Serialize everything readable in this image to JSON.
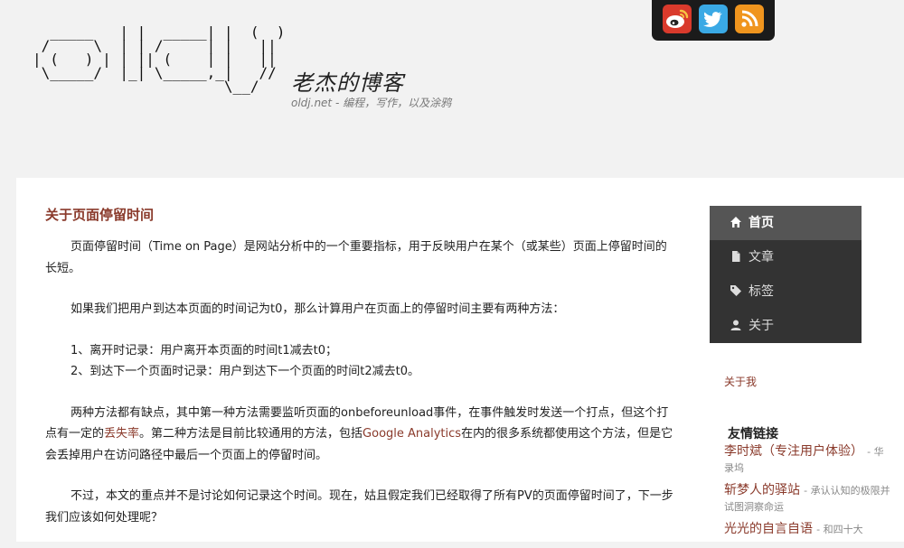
{
  "header": {
    "logo_ascii": "  _____   | |  _____| |  (  )\n /     \\  | | /     | |   ||\n| (   ) | | || (    | |   ||\n \\_____/  |_| \\_____,_|   //\n                      \\__/",
    "site_title": "老杰的博客",
    "site_subtitle": "oldj.net - 编程，写作，以及涂鸦"
  },
  "social": [
    {
      "name": "weibo",
      "icon": "weibo-icon",
      "color": "#d93a2c"
    },
    {
      "name": "twitter",
      "icon": "twitter-icon",
      "color": "#3aa9e5"
    },
    {
      "name": "rss",
      "icon": "rss-icon",
      "color": "#f0951e"
    }
  ],
  "article": {
    "title": "关于页面停留时间",
    "p1": "页面停留时间（Time on Page）是网站分析中的一个重要指标，用于反映用户在某个（或某些）页面上停留时间的长短。",
    "p2": "如果我们把用户到达本页面的时间记为t0，那么计算用户在页面上的停留时间主要有两种方法：",
    "list1": "1、离开时记录：用户离开本页面的时间t1减去t0；",
    "list2": "2、到达下一个页面时记录：用户到达下一个页面的时间t2减去t0。",
    "p3_a": "两种方法都有缺点，其中第一种方法需要监听页面的onbeforeunload事件，在事件触发时发送一个打点，但这个打点有一定的",
    "p3_link1": "丢失率",
    "p3_b": "。第二种方法是目前比较通用的方法，包括",
    "p3_link2": "Google Analytics",
    "p3_c": "在内的很多系统都使用这个方法，但是它会丢掉用户在访问路径中最后一个页面上的停留时间。",
    "p4": "不过，本文的重点并不是讨论如何记录这个时间。现在，姑且假定我们已经取得了所有PV的页面停留时间了，下一步我们应该如何处理呢？"
  },
  "nav": {
    "items": [
      {
        "label": "首页",
        "icon": "home-icon",
        "active": true
      },
      {
        "label": "文章",
        "icon": "document-icon",
        "active": false
      },
      {
        "label": "标签",
        "icon": "tag-icon",
        "active": false
      },
      {
        "label": "关于",
        "icon": "user-icon",
        "active": false
      }
    ]
  },
  "sidebar": {
    "about_link": "关于我",
    "friends_title": "友情链接",
    "friends": [
      {
        "name": "李时斌（专注用户体验）",
        "desc": "- 华录坞"
      },
      {
        "name": "斩梦人的驿站",
        "desc": "- 承认认知的极限并试图洞察命运"
      },
      {
        "name": "光光的自言自语",
        "desc": "- 和四十大"
      }
    ]
  }
}
